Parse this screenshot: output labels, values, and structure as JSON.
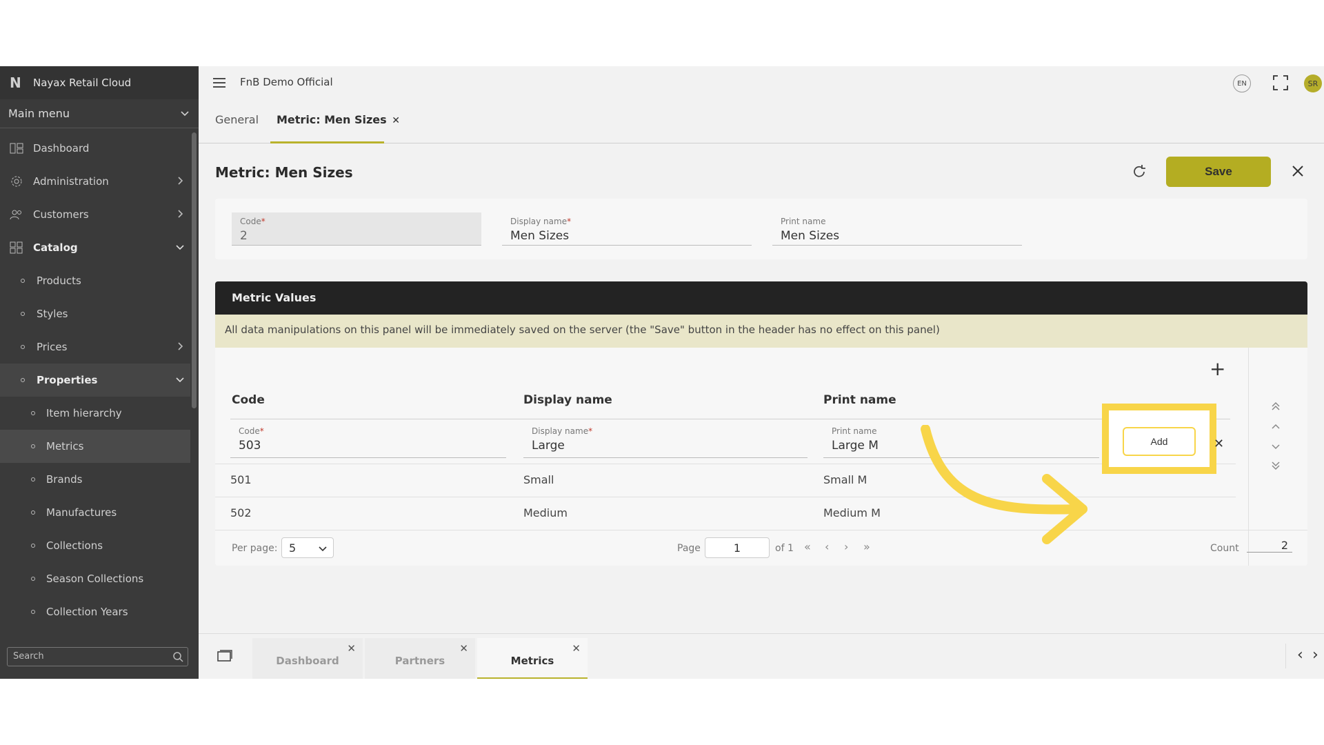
{
  "sidebar": {
    "brand_logo": "N",
    "brand_name": "Nayax Retail Cloud",
    "main_menu": "Main menu",
    "items": [
      {
        "label": "Dashboard"
      },
      {
        "label": "Administration"
      },
      {
        "label": "Customers"
      },
      {
        "label": "Catalog"
      },
      {
        "label": "Products"
      },
      {
        "label": "Styles"
      },
      {
        "label": "Prices"
      },
      {
        "label": "Properties"
      },
      {
        "label": "Item hierarchy"
      },
      {
        "label": "Metrics"
      },
      {
        "label": "Brands"
      },
      {
        "label": "Manufactures"
      },
      {
        "label": "Collections"
      },
      {
        "label": "Season Collections"
      },
      {
        "label": "Collection Years"
      }
    ],
    "search_placeholder": "Search"
  },
  "topbar": {
    "company": "FnB Demo Official",
    "lang": "EN",
    "avatar": "SR"
  },
  "tabs": [
    {
      "label": "General"
    },
    {
      "label": "Metric: Men Sizes"
    }
  ],
  "form": {
    "title": "Metric: Men Sizes",
    "save_label": "Save",
    "code_label": "Code",
    "code_value": "2",
    "display_label": "Display name",
    "display_value": "Men Sizes",
    "print_label": "Print name",
    "print_value": "Men Sizes"
  },
  "metric_values": {
    "title": "Metric Values",
    "note": "All data manipulations on this panel will be immediately saved on the server (the \"Save\" button in the header has no effect on this panel)",
    "columns": [
      "Code",
      "Display name",
      "Print name"
    ],
    "new_row": {
      "code_label": "Code",
      "code_value": "503",
      "display_label": "Display name",
      "display_value": "Large",
      "print_label": "Print name",
      "print_value": "Large M"
    },
    "rows": [
      {
        "code": "501",
        "display": "Small",
        "print": "Small M"
      },
      {
        "code": "502",
        "display": "Medium",
        "print": "Medium M"
      }
    ],
    "add_label": "Add",
    "per_page_label": "Per page:",
    "per_page_value": "5",
    "page_label": "Page",
    "page_value": "1",
    "of_label": "of 1",
    "count_label": "Count",
    "count_value": "2"
  },
  "bottom_tabs": [
    {
      "label": "Dashboard"
    },
    {
      "label": "Partners"
    },
    {
      "label": "Metrics"
    }
  ],
  "colors": {
    "accent": "#b4ad22",
    "highlight": "#f8d549",
    "sidebar": "#3a3a3a"
  }
}
